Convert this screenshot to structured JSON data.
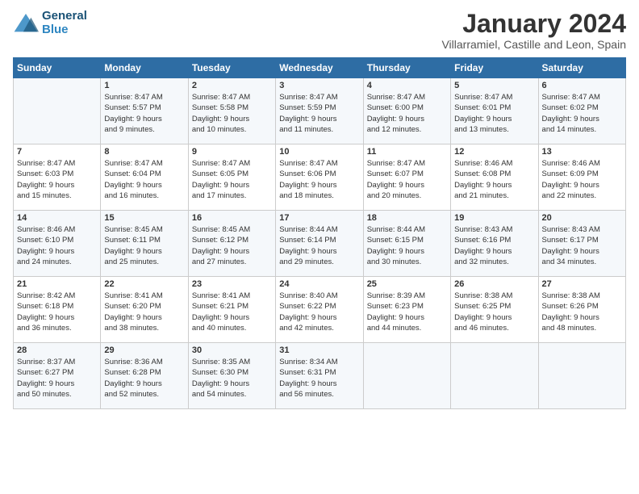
{
  "logo": {
    "line1": "General",
    "line2": "Blue"
  },
  "title": "January 2024",
  "subtitle": "Villarramiel, Castille and Leon, Spain",
  "headers": [
    "Sunday",
    "Monday",
    "Tuesday",
    "Wednesday",
    "Thursday",
    "Friday",
    "Saturday"
  ],
  "weeks": [
    [
      {
        "day": "",
        "lines": []
      },
      {
        "day": "1",
        "lines": [
          "Sunrise: 8:47 AM",
          "Sunset: 5:57 PM",
          "Daylight: 9 hours",
          "and 9 minutes."
        ]
      },
      {
        "day": "2",
        "lines": [
          "Sunrise: 8:47 AM",
          "Sunset: 5:58 PM",
          "Daylight: 9 hours",
          "and 10 minutes."
        ]
      },
      {
        "day": "3",
        "lines": [
          "Sunrise: 8:47 AM",
          "Sunset: 5:59 PM",
          "Daylight: 9 hours",
          "and 11 minutes."
        ]
      },
      {
        "day": "4",
        "lines": [
          "Sunrise: 8:47 AM",
          "Sunset: 6:00 PM",
          "Daylight: 9 hours",
          "and 12 minutes."
        ]
      },
      {
        "day": "5",
        "lines": [
          "Sunrise: 8:47 AM",
          "Sunset: 6:01 PM",
          "Daylight: 9 hours",
          "and 13 minutes."
        ]
      },
      {
        "day": "6",
        "lines": [
          "Sunrise: 8:47 AM",
          "Sunset: 6:02 PM",
          "Daylight: 9 hours",
          "and 14 minutes."
        ]
      }
    ],
    [
      {
        "day": "7",
        "lines": [
          "Sunrise: 8:47 AM",
          "Sunset: 6:03 PM",
          "Daylight: 9 hours",
          "and 15 minutes."
        ]
      },
      {
        "day": "8",
        "lines": [
          "Sunrise: 8:47 AM",
          "Sunset: 6:04 PM",
          "Daylight: 9 hours",
          "and 16 minutes."
        ]
      },
      {
        "day": "9",
        "lines": [
          "Sunrise: 8:47 AM",
          "Sunset: 6:05 PM",
          "Daylight: 9 hours",
          "and 17 minutes."
        ]
      },
      {
        "day": "10",
        "lines": [
          "Sunrise: 8:47 AM",
          "Sunset: 6:06 PM",
          "Daylight: 9 hours",
          "and 18 minutes."
        ]
      },
      {
        "day": "11",
        "lines": [
          "Sunrise: 8:47 AM",
          "Sunset: 6:07 PM",
          "Daylight: 9 hours",
          "and 20 minutes."
        ]
      },
      {
        "day": "12",
        "lines": [
          "Sunrise: 8:46 AM",
          "Sunset: 6:08 PM",
          "Daylight: 9 hours",
          "and 21 minutes."
        ]
      },
      {
        "day": "13",
        "lines": [
          "Sunrise: 8:46 AM",
          "Sunset: 6:09 PM",
          "Daylight: 9 hours",
          "and 22 minutes."
        ]
      }
    ],
    [
      {
        "day": "14",
        "lines": [
          "Sunrise: 8:46 AM",
          "Sunset: 6:10 PM",
          "Daylight: 9 hours",
          "and 24 minutes."
        ]
      },
      {
        "day": "15",
        "lines": [
          "Sunrise: 8:45 AM",
          "Sunset: 6:11 PM",
          "Daylight: 9 hours",
          "and 25 minutes."
        ]
      },
      {
        "day": "16",
        "lines": [
          "Sunrise: 8:45 AM",
          "Sunset: 6:12 PM",
          "Daylight: 9 hours",
          "and 27 minutes."
        ]
      },
      {
        "day": "17",
        "lines": [
          "Sunrise: 8:44 AM",
          "Sunset: 6:14 PM",
          "Daylight: 9 hours",
          "and 29 minutes."
        ]
      },
      {
        "day": "18",
        "lines": [
          "Sunrise: 8:44 AM",
          "Sunset: 6:15 PM",
          "Daylight: 9 hours",
          "and 30 minutes."
        ]
      },
      {
        "day": "19",
        "lines": [
          "Sunrise: 8:43 AM",
          "Sunset: 6:16 PM",
          "Daylight: 9 hours",
          "and 32 minutes."
        ]
      },
      {
        "day": "20",
        "lines": [
          "Sunrise: 8:43 AM",
          "Sunset: 6:17 PM",
          "Daylight: 9 hours",
          "and 34 minutes."
        ]
      }
    ],
    [
      {
        "day": "21",
        "lines": [
          "Sunrise: 8:42 AM",
          "Sunset: 6:18 PM",
          "Daylight: 9 hours",
          "and 36 minutes."
        ]
      },
      {
        "day": "22",
        "lines": [
          "Sunrise: 8:41 AM",
          "Sunset: 6:20 PM",
          "Daylight: 9 hours",
          "and 38 minutes."
        ]
      },
      {
        "day": "23",
        "lines": [
          "Sunrise: 8:41 AM",
          "Sunset: 6:21 PM",
          "Daylight: 9 hours",
          "and 40 minutes."
        ]
      },
      {
        "day": "24",
        "lines": [
          "Sunrise: 8:40 AM",
          "Sunset: 6:22 PM",
          "Daylight: 9 hours",
          "and 42 minutes."
        ]
      },
      {
        "day": "25",
        "lines": [
          "Sunrise: 8:39 AM",
          "Sunset: 6:23 PM",
          "Daylight: 9 hours",
          "and 44 minutes."
        ]
      },
      {
        "day": "26",
        "lines": [
          "Sunrise: 8:38 AM",
          "Sunset: 6:25 PM",
          "Daylight: 9 hours",
          "and 46 minutes."
        ]
      },
      {
        "day": "27",
        "lines": [
          "Sunrise: 8:38 AM",
          "Sunset: 6:26 PM",
          "Daylight: 9 hours",
          "and 48 minutes."
        ]
      }
    ],
    [
      {
        "day": "28",
        "lines": [
          "Sunrise: 8:37 AM",
          "Sunset: 6:27 PM",
          "Daylight: 9 hours",
          "and 50 minutes."
        ]
      },
      {
        "day": "29",
        "lines": [
          "Sunrise: 8:36 AM",
          "Sunset: 6:28 PM",
          "Daylight: 9 hours",
          "and 52 minutes."
        ]
      },
      {
        "day": "30",
        "lines": [
          "Sunrise: 8:35 AM",
          "Sunset: 6:30 PM",
          "Daylight: 9 hours",
          "and 54 minutes."
        ]
      },
      {
        "day": "31",
        "lines": [
          "Sunrise: 8:34 AM",
          "Sunset: 6:31 PM",
          "Daylight: 9 hours",
          "and 56 minutes."
        ]
      },
      {
        "day": "",
        "lines": []
      },
      {
        "day": "",
        "lines": []
      },
      {
        "day": "",
        "lines": []
      }
    ]
  ]
}
